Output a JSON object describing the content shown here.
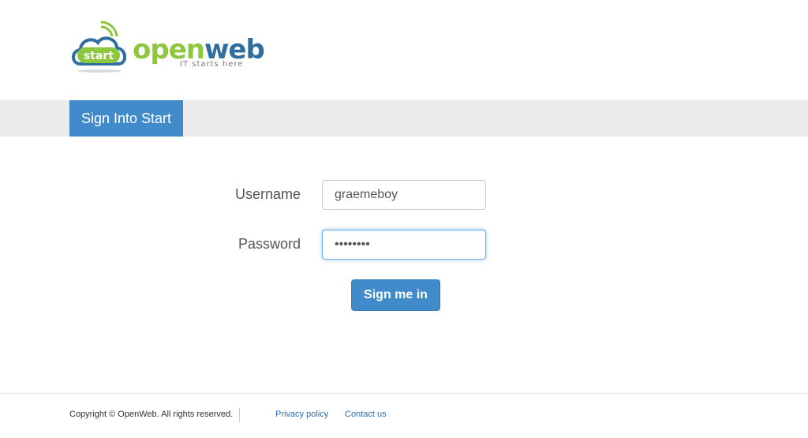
{
  "logo": {
    "badge_text": "start",
    "name_part1": "open",
    "name_part2": "web",
    "tagline": "IT starts here",
    "colors": {
      "green": "#8dc63f",
      "blue": "#2f6e9e"
    }
  },
  "nav": {
    "active_tab": "Sign Into Start"
  },
  "form": {
    "username_label": "Username",
    "username_value": "graemeboy",
    "password_label": "Password",
    "password_value": "••••••••",
    "submit_label": "Sign me in"
  },
  "footer": {
    "copyright": "Copyright © OpenWeb. All rights reserved.",
    "privacy_link": "Privacy policy",
    "contact_link": "Contact us"
  },
  "colors": {
    "accent": "#428bca",
    "nav_bg": "#ebebeb",
    "link": "#2a6ebb"
  }
}
